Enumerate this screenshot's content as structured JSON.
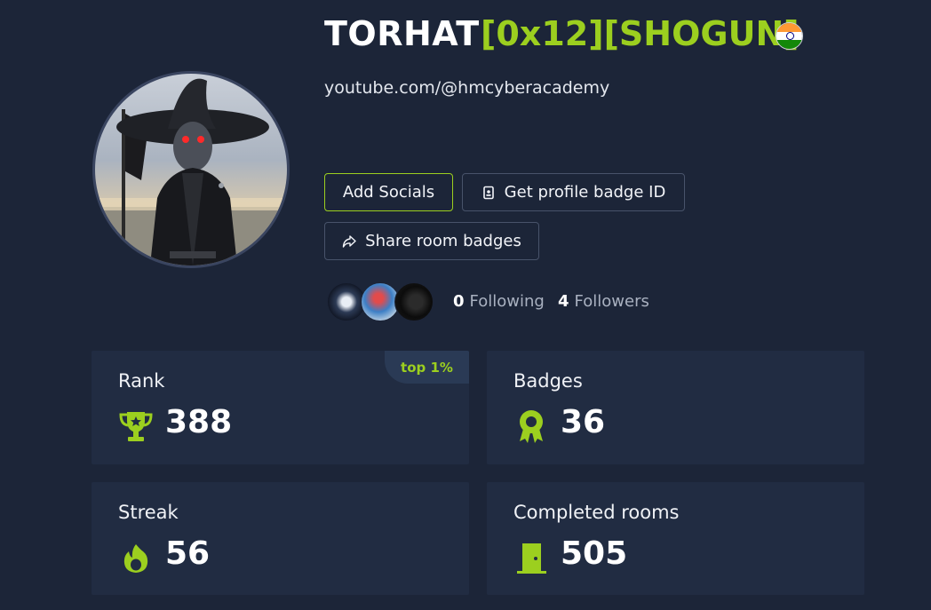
{
  "profile": {
    "username": "TORHAT",
    "rank_title": "[0x12][SHOGUN]",
    "country_flag_icon": "india-flag-icon",
    "social_link": "youtube.com/@hmcyberacademy"
  },
  "actions": {
    "add_socials": "Add Socials",
    "get_badge_id": "Get profile badge ID",
    "share_badges": "Share room badges"
  },
  "follow": {
    "following_count": "0",
    "following_label": "Following",
    "followers_count": "4",
    "followers_label": "Followers"
  },
  "stats": {
    "rank": {
      "label": "Rank",
      "value": "388",
      "tag": "top 1%",
      "icon": "trophy-icon"
    },
    "badges": {
      "label": "Badges",
      "value": "36",
      "icon": "award-icon"
    },
    "streak": {
      "label": "Streak",
      "value": "56",
      "icon": "flame-icon"
    },
    "rooms": {
      "label": "Completed rooms",
      "value": "505",
      "icon": "door-icon"
    }
  },
  "colors": {
    "background": "#1c2538",
    "card": "#212c42",
    "accent": "#9ccf1f"
  }
}
